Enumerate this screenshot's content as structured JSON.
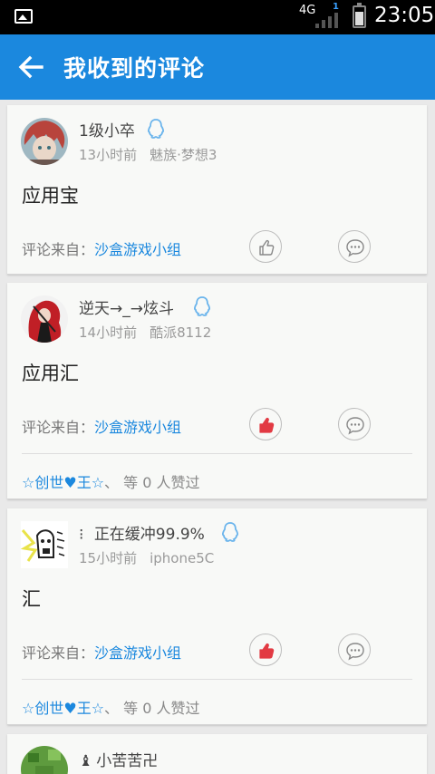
{
  "status_bar": {
    "network": "4G",
    "sim_slot": "1",
    "time": "23:05"
  },
  "app_bar": {
    "title": "我收到的评论",
    "back_icon": "arrow-left-icon"
  },
  "colors": {
    "brand": "#1b88de",
    "like_active": "#e23a43",
    "qq_icon": "#6ab4ec"
  },
  "comments": [
    {
      "user": "1级小卒",
      "time": "13小时前",
      "device": "魅族·梦想3",
      "content": "应用宝",
      "source_label": "评论来自：",
      "source_group": "沙盒游戏小组",
      "liked": false,
      "likers": null
    },
    {
      "user": "逆天→_→炫斗",
      "time": "14小时前",
      "device": "酷派8112",
      "content": "应用汇",
      "source_label": "评论来自：",
      "source_group": "沙盒游戏小组",
      "liked": true,
      "likers": {
        "name": "☆创世♥王☆",
        "rest": "、 等 0 人赞过"
      }
    },
    {
      "user": "正在缓冲99.9%",
      "user_prefix": "⁝",
      "time": "15小时前",
      "device": "iphone5C",
      "content": "汇",
      "source_label": "评论来自：",
      "source_group": "沙盒游戏小组",
      "liked": true,
      "likers": {
        "name": "☆创世♥王☆",
        "rest": "、 等 0 人赞过"
      }
    },
    {
      "user": "小苦苦卍",
      "user_prefix": "♝"
    }
  ]
}
